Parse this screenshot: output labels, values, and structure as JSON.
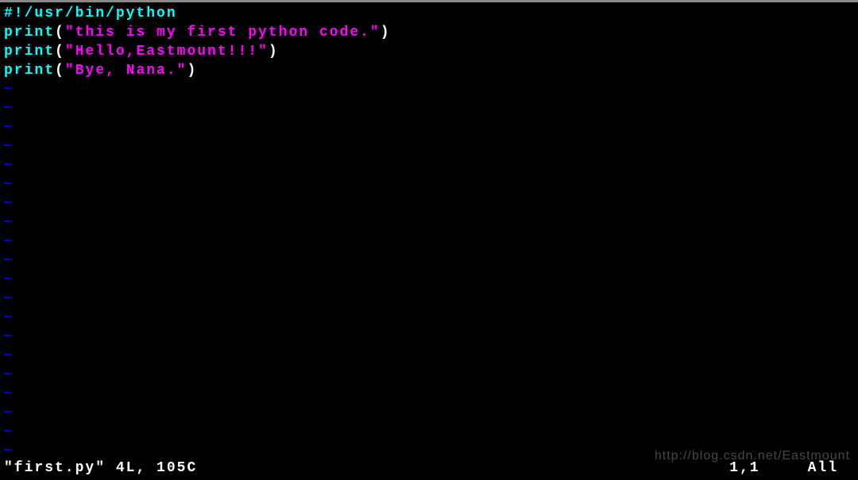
{
  "editor": {
    "shebang": "#!/usr/bin/python",
    "lines": [
      {
        "func": "print",
        "string": "\"this is my first python code.\""
      },
      {
        "func": "print",
        "string": "\"Hello,Eastmount!!!\""
      },
      {
        "func": "print",
        "string": "\"Bye, Nana.\""
      }
    ],
    "tilde": "~"
  },
  "statusbar": {
    "filename": "\"first.py\"",
    "fileinfo": "4L, 105C",
    "position": "1,1",
    "scroll": "All"
  },
  "watermark": "http://blog.csdn.net/Eastmount"
}
